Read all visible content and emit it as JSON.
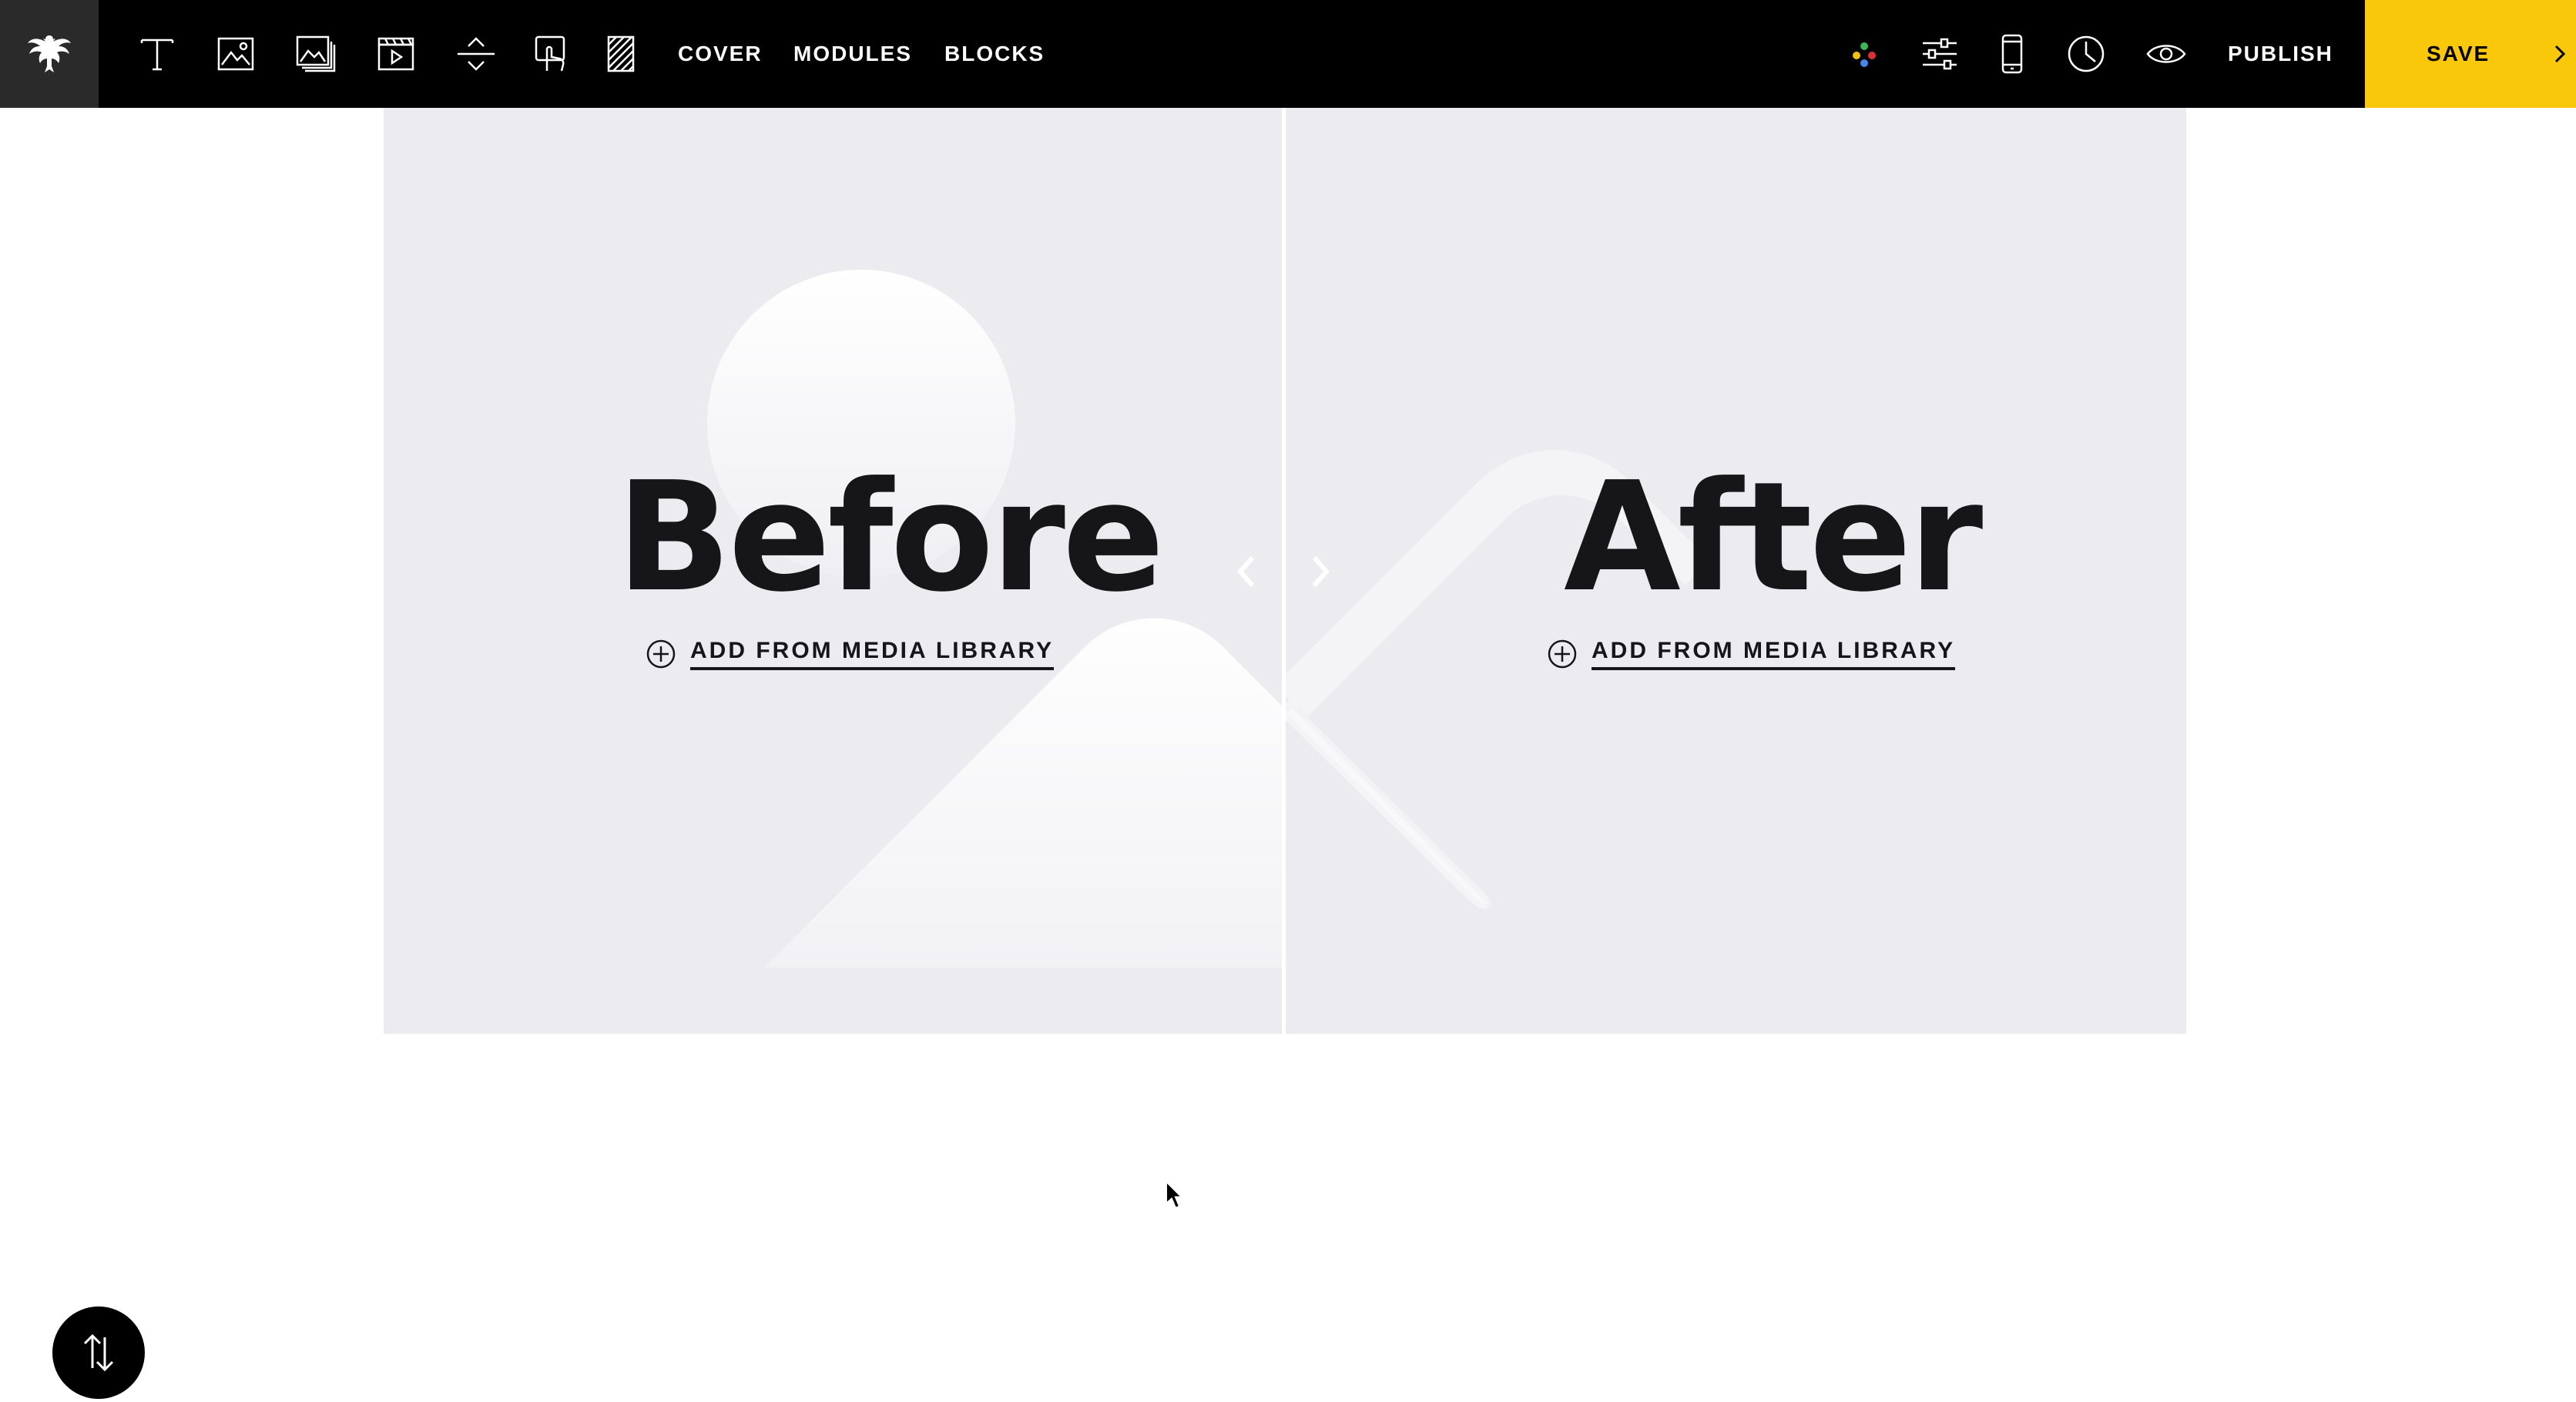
{
  "toolbar": {
    "logo_icon": "eagle-logo-icon",
    "tools": [
      {
        "name": "text-tool",
        "icon": "text-icon"
      },
      {
        "name": "image-tool",
        "icon": "image-icon"
      },
      {
        "name": "gallery-tool",
        "icon": "gallery-icon"
      },
      {
        "name": "video-tool",
        "icon": "video-icon"
      },
      {
        "name": "spacer-tool",
        "icon": "spacer-icon"
      },
      {
        "name": "interactive-tool",
        "icon": "touch-icon"
      },
      {
        "name": "pattern-tool",
        "icon": "hatch-icon"
      }
    ],
    "menu": {
      "cover": "COVER",
      "modules": "MODULES",
      "blocks": "BLOCKS"
    },
    "right_icons": [
      "palette-icon",
      "sliders-icon",
      "mobile-icon",
      "history-icon",
      "preview-icon"
    ],
    "publish": "PUBLISH",
    "save": "SAVE",
    "save_color": "#f9c80b"
  },
  "compare": {
    "before": {
      "title": "Before",
      "add_media": "ADD FROM MEDIA LIBRARY"
    },
    "after": {
      "title": "After",
      "add_media": "ADD FROM MEDIA LIBRARY"
    },
    "background_color": "#ebebf0"
  },
  "fab": {
    "icon": "reorder-arrows-icon"
  }
}
